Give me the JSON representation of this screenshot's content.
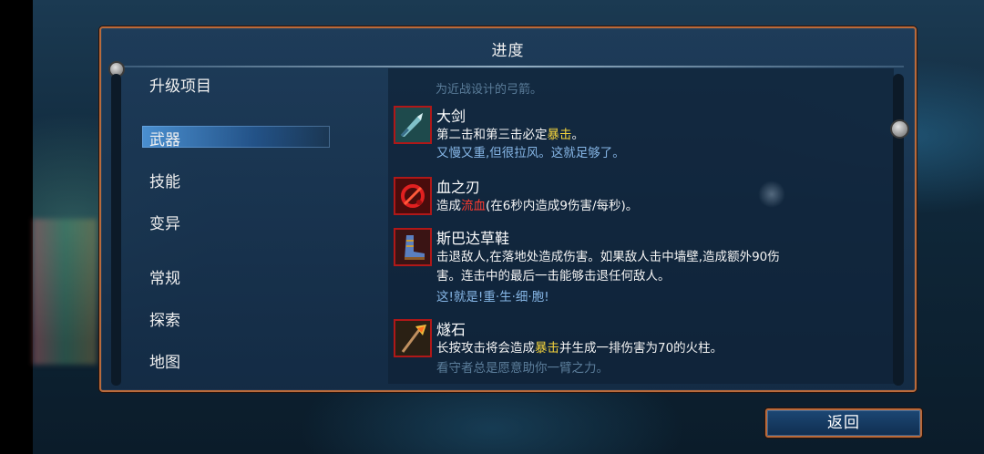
{
  "panel": {
    "title": "进度"
  },
  "sidebar": {
    "items": [
      {
        "label": "升级项目"
      },
      {
        "label": "武器",
        "selected": true
      },
      {
        "label": "技能"
      },
      {
        "label": "变异"
      },
      {
        "label": "常规"
      },
      {
        "label": "探索"
      },
      {
        "label": "地图"
      }
    ]
  },
  "content": {
    "top_fade_text": "为近战设计的弓箭。",
    "entries": [
      {
        "name": "大剑",
        "icon": "greatsword-icon",
        "desc_parts": [
          "第二击和第三击必定",
          "暴击",
          "。"
        ],
        "flavor": "又慢又重,但很拉风。这就足够了。"
      },
      {
        "name": "血之刃",
        "icon": "blood-sword-icon",
        "desc_parts": [
          "造成",
          "流血",
          "(在6秒内造成9伤害/每秒)。"
        ]
      },
      {
        "name": "斯巴达草鞋",
        "icon": "spartan-sandals-icon",
        "desc_line1": "击退敌人,在落地处造成伤害。如果敌人击中墙壁,造成额外90伤",
        "desc_line2": "害。连击中的最后一击能够击退任何敌人。",
        "flavor": "这!就是!重·生·细·胞!"
      },
      {
        "name": "燧石",
        "icon": "flint-icon",
        "desc_parts": [
          "长按攻击将会造成",
          "暴击",
          "并生成一排伤害为70的火柱。"
        ],
        "flavor": "看守者总是愿意助你一臂之力。"
      }
    ]
  },
  "footer": {
    "back_label": "返回"
  },
  "colors": {
    "accent_border": "#b86a3c",
    "keyword_crit": "#f2d23c",
    "keyword_bleed": "#ff3a2e",
    "flavor_text": "#86b6e6",
    "selected_item": "#4a8fd0"
  }
}
